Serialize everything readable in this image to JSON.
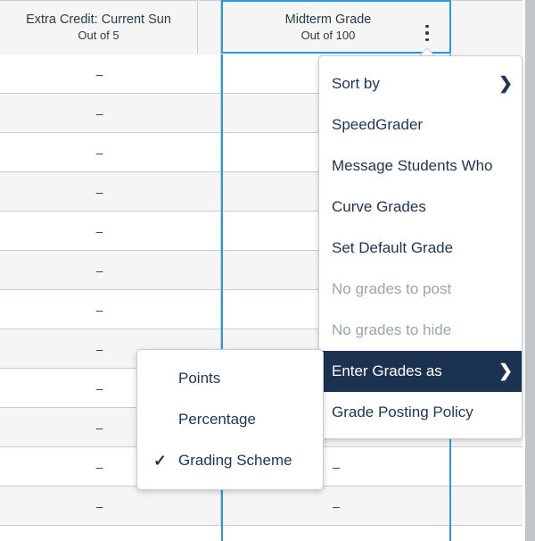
{
  "gradebook": {
    "columns": [
      {
        "id": "extra-credit",
        "title": "Extra Credit: Current Sun",
        "subtitle": "Out of 5"
      },
      {
        "id": "midterm-grade",
        "title": "Midterm Grade",
        "subtitle": "Out of 100"
      }
    ],
    "active_column": "midterm-grade",
    "highlight_color": "#2b98e0",
    "empty_value": "–",
    "rows": [
      {
        "extra_credit": "–",
        "midterm_grade": ""
      },
      {
        "extra_credit": "–",
        "midterm_grade": ""
      },
      {
        "extra_credit": "–",
        "midterm_grade": ""
      },
      {
        "extra_credit": "–",
        "midterm_grade": ""
      },
      {
        "extra_credit": "–",
        "midterm_grade": ""
      },
      {
        "extra_credit": "–",
        "midterm_grade": ""
      },
      {
        "extra_credit": "–",
        "midterm_grade": ""
      },
      {
        "extra_credit": "–",
        "midterm_grade": ""
      },
      {
        "extra_credit": "–",
        "midterm_grade": ""
      },
      {
        "extra_credit": "–",
        "midterm_grade": ""
      },
      {
        "extra_credit": "–",
        "midterm_grade": "–"
      },
      {
        "extra_credit": "–",
        "midterm_grade": "–"
      }
    ]
  },
  "column_menu": {
    "trigger_icon": "kebab-menu-icon",
    "items": [
      {
        "label": "Sort by",
        "state": "normal",
        "submenu": true,
        "chevron": "❯"
      },
      {
        "label": "SpeedGrader",
        "state": "normal",
        "submenu": false,
        "chevron": ""
      },
      {
        "label": "Message Students Who",
        "state": "normal",
        "submenu": false,
        "chevron": ""
      },
      {
        "label": "Curve Grades",
        "state": "normal",
        "submenu": false,
        "chevron": ""
      },
      {
        "label": "Set Default Grade",
        "state": "normal",
        "submenu": false,
        "chevron": ""
      },
      {
        "label": "No grades to post",
        "state": "disabled",
        "submenu": false,
        "chevron": ""
      },
      {
        "label": "No grades to hide",
        "state": "disabled",
        "submenu": false,
        "chevron": ""
      },
      {
        "label": "Enter Grades as",
        "state": "active",
        "submenu": true,
        "chevron": "❯"
      },
      {
        "label": "Grade Posting Policy",
        "state": "normal",
        "submenu": false,
        "chevron": ""
      }
    ],
    "active_item_color": "#1b3350"
  },
  "enter_grades_submenu": {
    "items": [
      {
        "label": "Points",
        "selected": false,
        "check": ""
      },
      {
        "label": "Percentage",
        "selected": false,
        "check": ""
      },
      {
        "label": "Grading Scheme",
        "selected": true,
        "check": "✓"
      }
    ]
  },
  "scrollbar": {
    "name": "vertical-scrollbar",
    "thumb_color": "#c2c5c8"
  }
}
